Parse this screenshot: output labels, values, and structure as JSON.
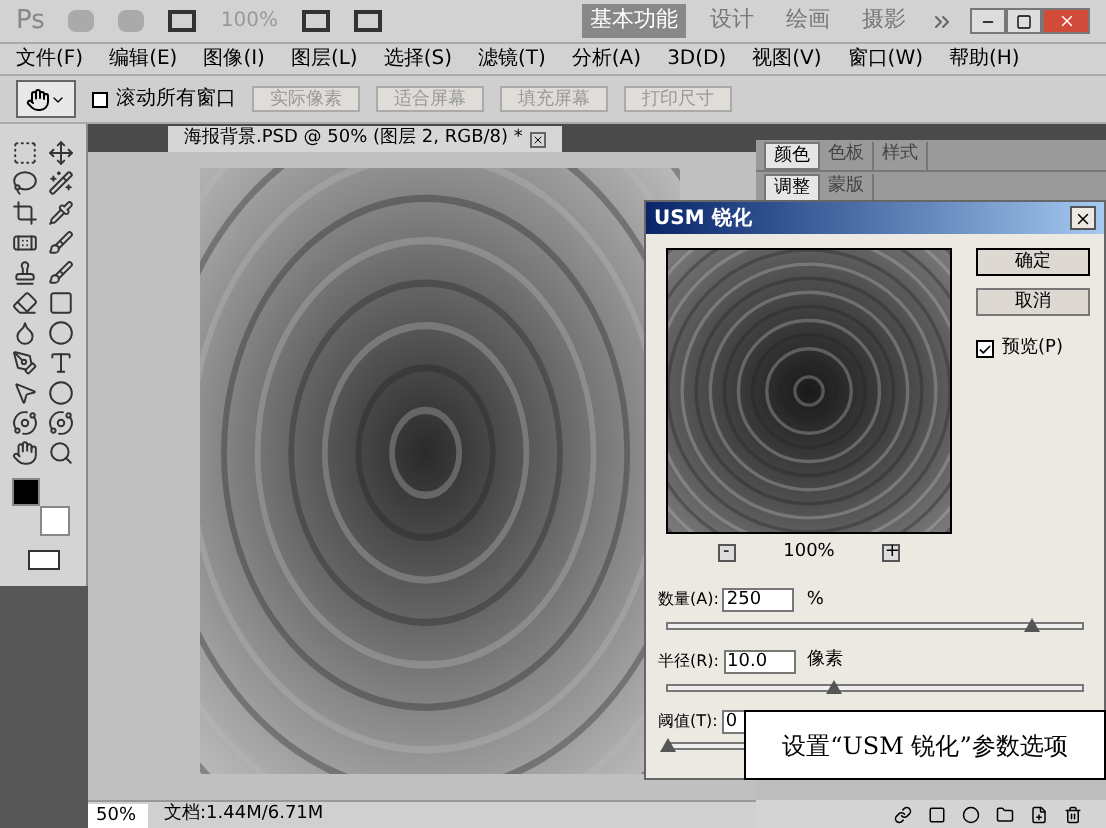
{
  "app_bar": {
    "logo": "Ps",
    "zoom": "100%",
    "workspaces": [
      {
        "label": "基本功能",
        "selected": true
      },
      {
        "label": "设计",
        "selected": false
      },
      {
        "label": "绘画",
        "selected": false
      },
      {
        "label": "摄影",
        "selected": false
      }
    ]
  },
  "menu": [
    "文件(F)",
    "编辑(E)",
    "图像(I)",
    "图层(L)",
    "选择(S)",
    "滤镜(T)",
    "分析(A)",
    "3D(D)",
    "视图(V)",
    "窗口(W)",
    "帮助(H)"
  ],
  "options_bar": {
    "scroll_all": {
      "label": "滚动所有窗口",
      "checked": false
    },
    "buttons": [
      "实际像素",
      "适合屏幕",
      "填充屏幕",
      "打印尺寸"
    ]
  },
  "document": {
    "tab": "海报背景.PSD @ 50% (图层 2, RGB/8) *"
  },
  "panels": [
    {
      "tabs": [
        {
          "label": "颜色",
          "selected": true
        },
        {
          "label": "色板",
          "selected": false
        },
        {
          "label": "样式",
          "selected": false
        }
      ]
    },
    {
      "tabs": [
        {
          "label": "调整",
          "selected": true
        },
        {
          "label": "蒙版",
          "selected": false
        }
      ]
    }
  ],
  "dialog": {
    "title": "USM 锐化",
    "ok": "确定",
    "cancel": "取消",
    "preview": {
      "label": "预览(P)",
      "checked": true
    },
    "zoom_out": "-",
    "zoom": "100%",
    "zoom_in": "+",
    "fields": [
      {
        "label": "数量(A):",
        "value": "250",
        "unit": "%",
        "level": 0.88
      },
      {
        "label": "半径(R):",
        "value": "10.0",
        "unit": "像素",
        "level": 0.4
      },
      {
        "label": "阈值(T):",
        "value": "0",
        "level": 0.0
      }
    ]
  },
  "callout": "设置“USM 锐化”参数选项",
  "status_bar": {
    "zoom": "50%",
    "document": "文档:1.44M/6.71M"
  }
}
